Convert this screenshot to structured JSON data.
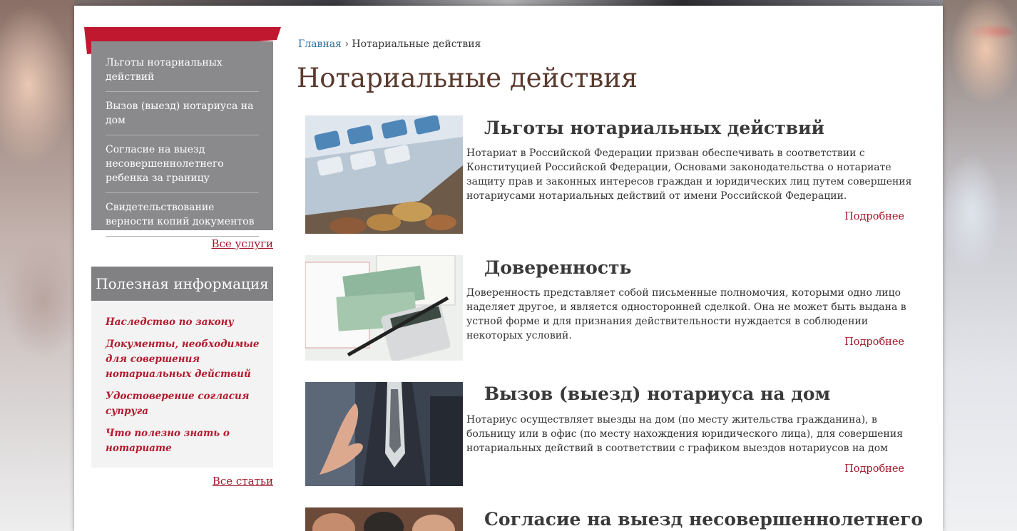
{
  "sidebar": {
    "services": [
      "Льготы нотариальных действий",
      "Вызов (выезд) нотариуса на дом",
      "Согласие на выезд несовершеннолетнего ребенка за границу",
      "Свидетельствование верности копий документов"
    ],
    "all_services_label": "Все услуги",
    "info_title": "Полезная информация",
    "info_items": [
      "Наследство по закону",
      "Документы, необходимые для совершения нотариальных действий",
      "Удостоверение согласия супруга",
      "Что полезно знать о нотариате"
    ],
    "all_articles_label": "Все статьи"
  },
  "breadcrumb": {
    "home": "Главная",
    "separator": "›",
    "current": "Нотариальные действия"
  },
  "page_title": "Нотариальные действия",
  "articles": [
    {
      "title": "Льготы нотариальных действий",
      "text": "Нотариат в Российской Федерации призван обеспечивать в соответствии с Конституцией Российской Федерации, Основами законодательства о нотариате защиту прав и законных интересов граждан и юридических лиц путем совершения нотариусами нотариальных действий от имени Российской Федерации.",
      "more": "Подробнее",
      "image": "calculator-coins-image"
    },
    {
      "title": "Доверенность",
      "text": "Доверенность представляет собой письменные полномочия, которыми одно лицо наделяет другое, и является односторонней сделкой. Она не может быть выдана в устной форме и для признания действительности нуждается в соблюдении некоторых условий.",
      "more": "Подробнее",
      "image": "documents-money-calculator-image"
    },
    {
      "title": "Вызов (выезд) нотариуса на дом",
      "text": "Нотариус осуществляет выезды на дом (по месту жительства гражданина), в больницу или в офис (по месту нахождения юридического лица), для совершения нотариальных действий в соответствии с графиком выездов нотариусов на дом",
      "more": "Подробнее",
      "image": "handshake-businessman-image"
    },
    {
      "title": "Согласие на выезд несовершеннолетнего",
      "image": "people-image"
    }
  ],
  "colors": {
    "accent": "#a3152a",
    "sidebar_gray": "#8a8a8c",
    "title_brown": "#5a3a2e",
    "link_blue": "#2f6f9f"
  }
}
